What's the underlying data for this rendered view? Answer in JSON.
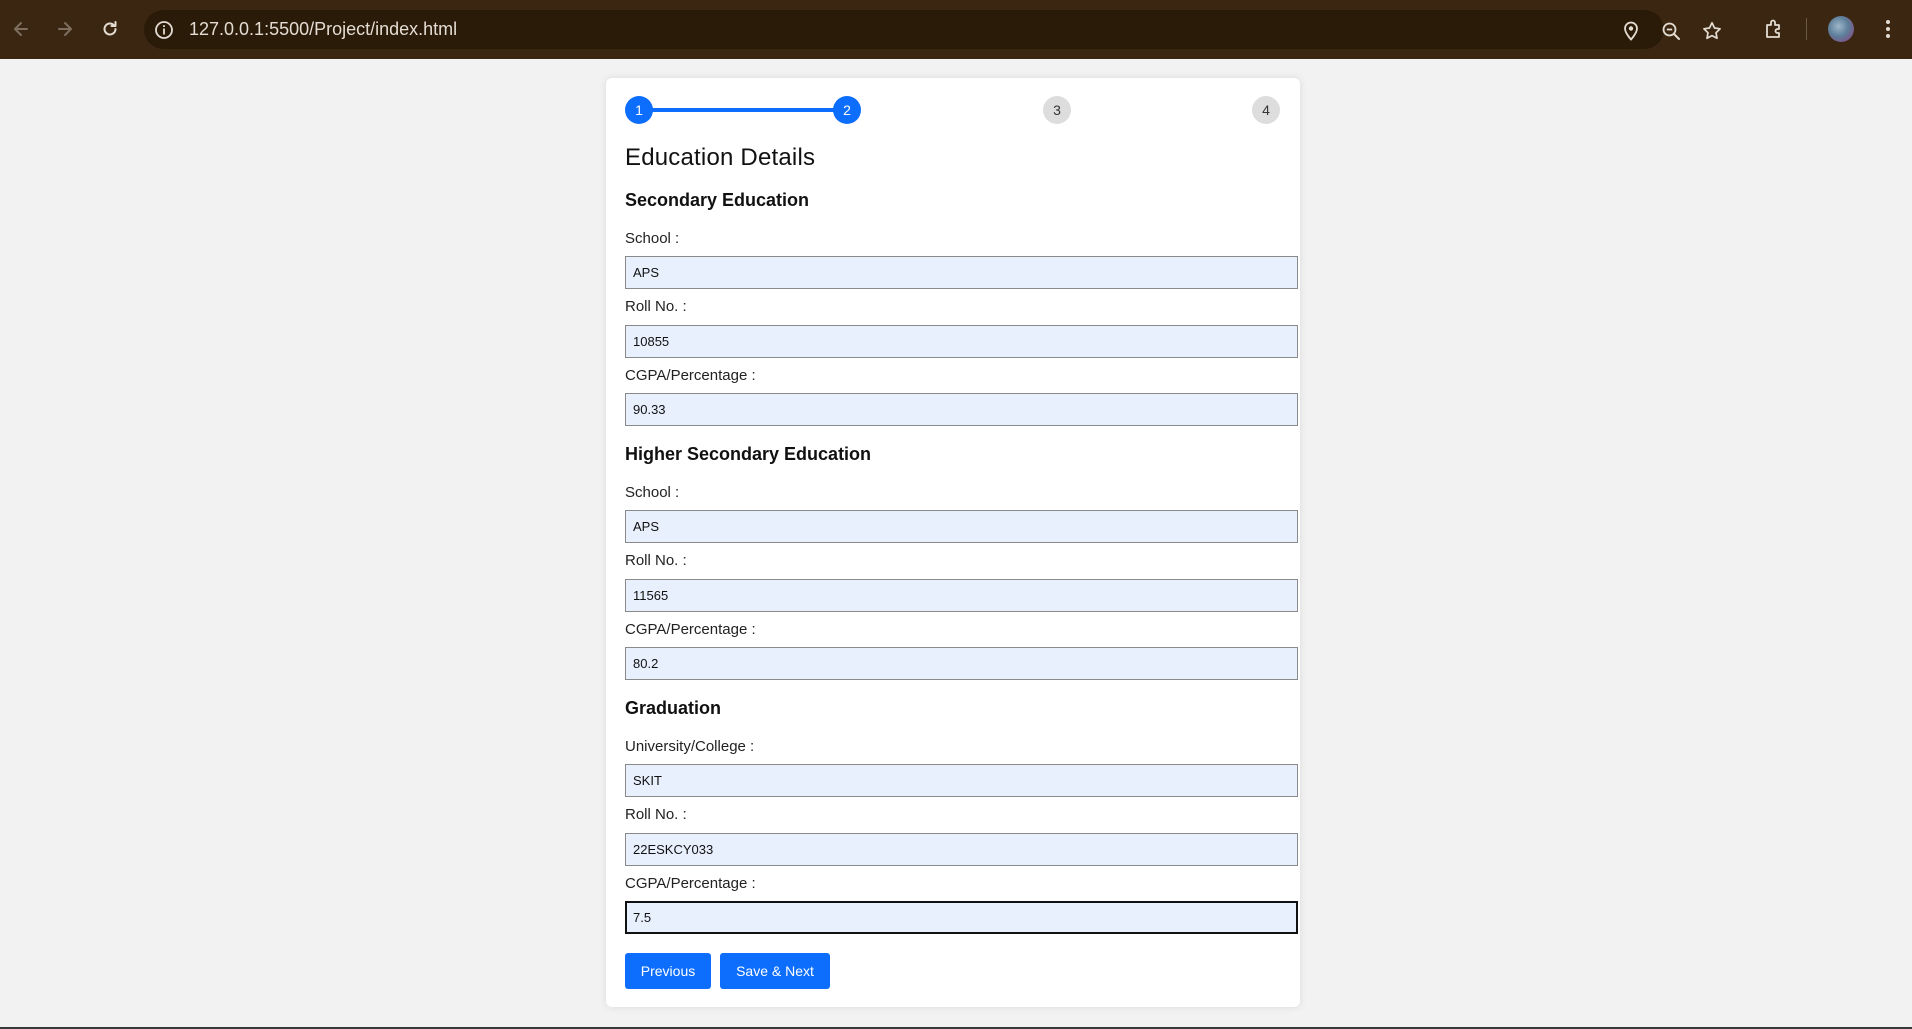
{
  "browser": {
    "url": "127.0.0.1:5500/Project/index.html",
    "icons": [
      "back-icon",
      "forward-icon",
      "reload-icon",
      "site-info-icon",
      "location-icon",
      "zoom-icon",
      "bookmark-star-icon",
      "extensions-icon",
      "profile-avatar",
      "menu-icon"
    ]
  },
  "colors": {
    "accent": "#0d6efd",
    "input_bg": "#e8f0fe",
    "chrome_bg": "#3a2611"
  },
  "steps": [
    "1",
    "2",
    "3",
    "4"
  ],
  "form": {
    "title": "Education Details",
    "secondary": {
      "heading": "Secondary Education",
      "school_label": "School :",
      "school_value": "APS",
      "roll_label": "Roll No. :",
      "roll_value": "10855",
      "cgpa_label": "CGPA/Percentage :",
      "cgpa_value": "90.33"
    },
    "higher_secondary": {
      "heading": "Higher Secondary Education",
      "school_label": "School :",
      "school_value": "APS",
      "roll_label": "Roll No. :",
      "roll_value": "11565",
      "cgpa_label": "CGPA/Percentage :",
      "cgpa_value": "80.2"
    },
    "graduation": {
      "heading": "Graduation",
      "college_label": "University/College :",
      "college_value": "SKIT",
      "roll_label": "Roll No. :",
      "roll_value": "22ESKCY033",
      "cgpa_label": "CGPA/Percentage :",
      "cgpa_value": "7.5"
    },
    "buttons": {
      "previous": "Previous",
      "save_next": "Save & Next"
    }
  }
}
